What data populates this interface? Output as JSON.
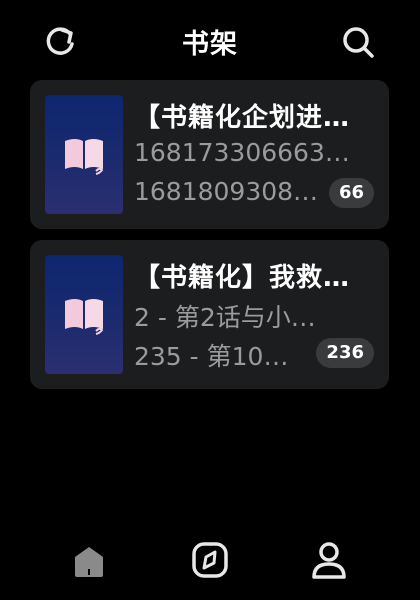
{
  "header": {
    "title": "书架",
    "refresh_icon": "refresh-icon",
    "search_icon": "search-icon"
  },
  "books": [
    {
      "title": "【书籍化企划进…",
      "line1": "168173306663…",
      "line2": "1681809308…",
      "badge": "66"
    },
    {
      "title": "【书籍化】我救…",
      "line1": "2 - 第2话与小…",
      "line2": "235 - 第10…",
      "badge": "236"
    }
  ],
  "bottom_nav": {
    "items": [
      "shelf-icon",
      "compass-icon",
      "user-icon"
    ],
    "active_color": "#8a8a8a"
  },
  "colors": {
    "background": "#000000",
    "card": "#1b1d1e",
    "cover_top": "#0d2670",
    "cover_bottom": "#2a2f70",
    "badge": "#3a3b3d",
    "secondary_text": "#9b9b9b"
  }
}
